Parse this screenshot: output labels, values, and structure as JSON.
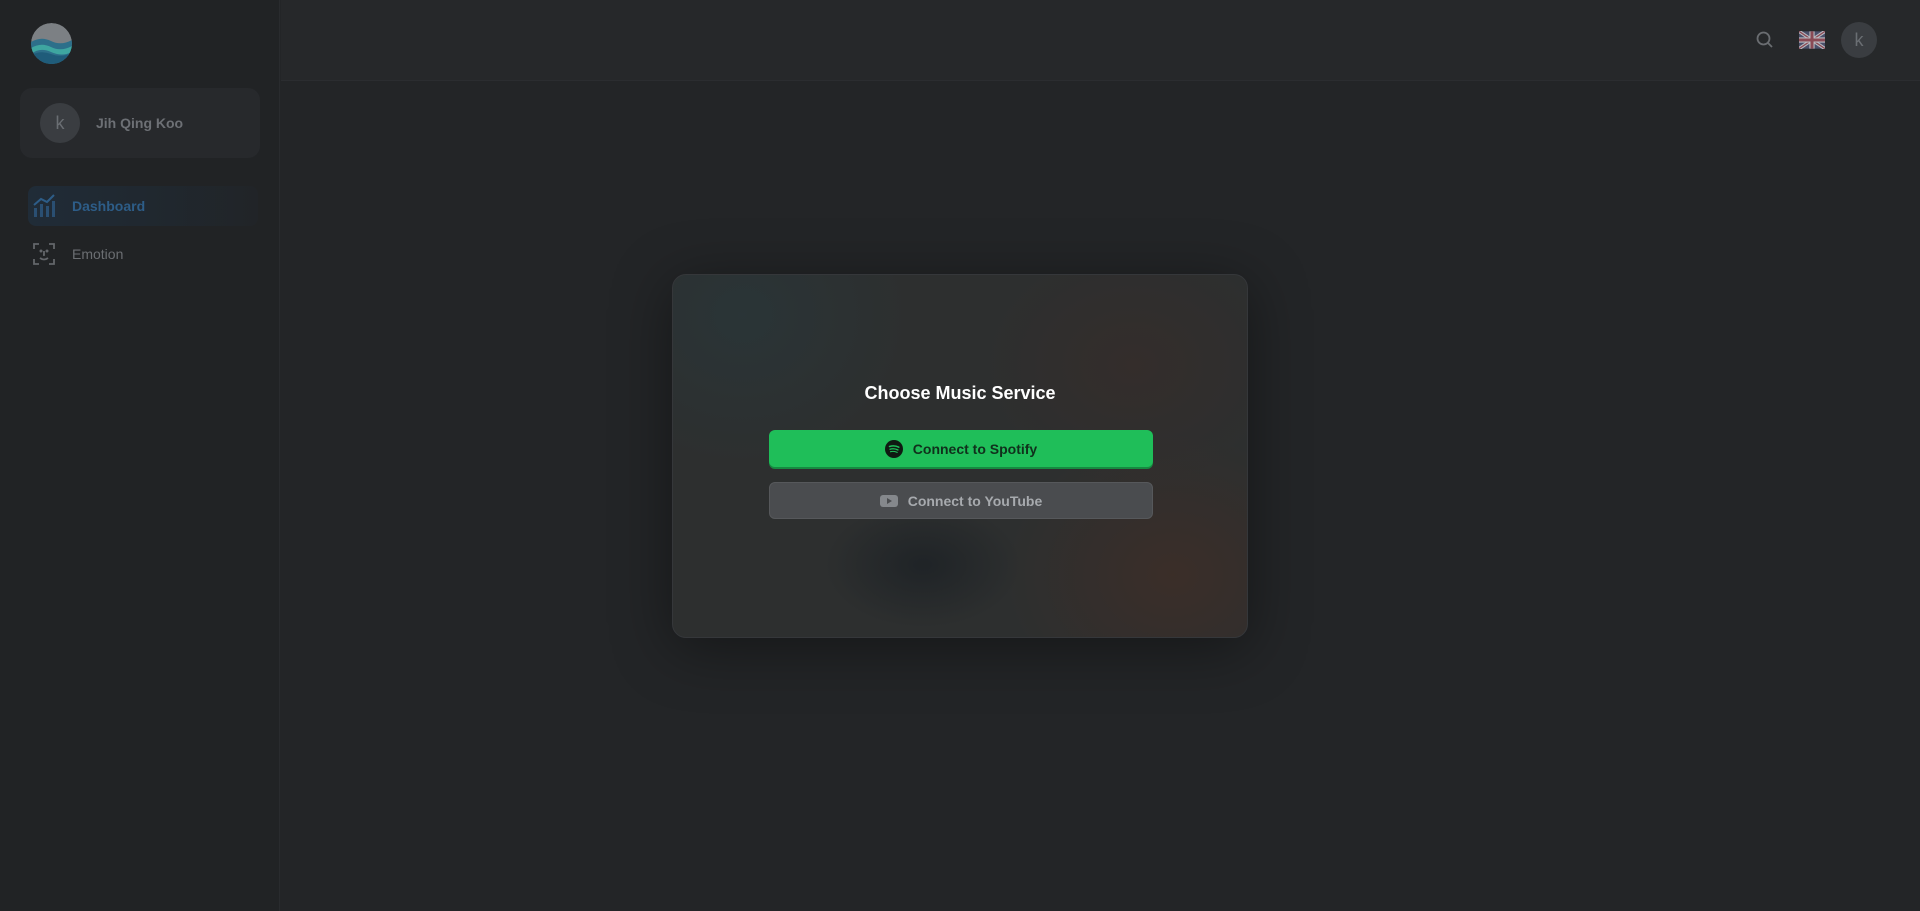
{
  "sidebar": {
    "user": {
      "initial": "k",
      "name": "Jih Qing Koo"
    },
    "items": [
      {
        "label": "Dashboard",
        "icon": "chart-icon",
        "active": true
      },
      {
        "label": "Emotion",
        "icon": "face-scan-icon",
        "active": false
      }
    ]
  },
  "header": {
    "search_icon": "search-icon",
    "language_icon": "uk-flag-icon",
    "avatar_initial": "k"
  },
  "modal": {
    "title": "Choose Music Service",
    "spotify_label": "Connect to Spotify",
    "youtube_label": "Connect to YouTube"
  },
  "colors": {
    "spotify_green": "#1fbe59",
    "background": "#232527",
    "active_nav": "#2d5d88"
  }
}
